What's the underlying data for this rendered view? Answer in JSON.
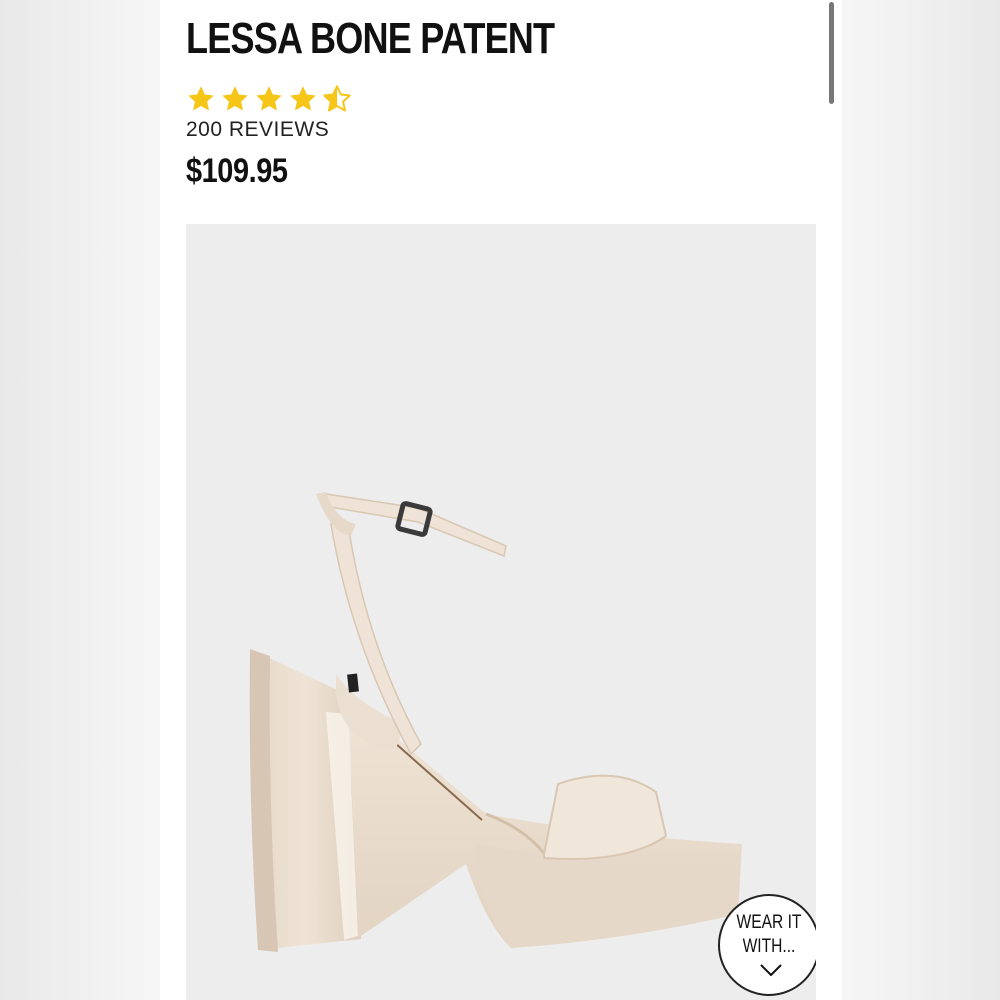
{
  "product": {
    "title": "LESSA BONE PATENT",
    "rating": 4.5,
    "rating_max": 5,
    "reviews_label": "200 REVIEWS",
    "price": "$109.95"
  },
  "icons": {
    "star": "star-icon",
    "half_star": "half-star-icon",
    "chevron": "chevron-down-icon"
  },
  "colors": {
    "star": "#f5c518",
    "image_background": "#ededed"
  },
  "wear_it_with": {
    "line1": "WEAR IT",
    "line2": "WITH..."
  }
}
